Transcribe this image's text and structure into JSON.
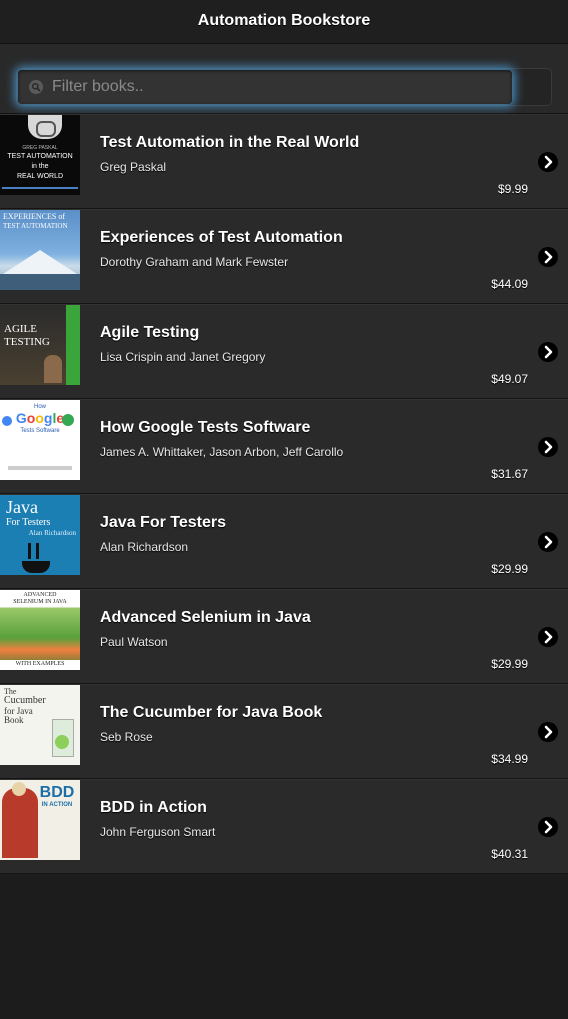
{
  "header": {
    "title": "Automation Bookstore"
  },
  "search": {
    "placeholder": "Filter books.."
  },
  "books": [
    {
      "title": "Test Automation in the Real World",
      "author": "Greg Paskal",
      "price": "$9.99",
      "cover_text": [
        "GREG PASKAL",
        "TEST AUTOMATION",
        "in the",
        "REAL WORLD"
      ]
    },
    {
      "title": "Experiences of Test Automation",
      "author": "Dorothy Graham and Mark Fewster",
      "price": "$44.09",
      "cover_text": [
        "EXPERIENCES of",
        "TEST AUTOMATION"
      ]
    },
    {
      "title": "Agile Testing",
      "author": "Lisa Crispin and Janet Gregory",
      "price": "$49.07",
      "cover_text": [
        "AGILE",
        "TESTING"
      ]
    },
    {
      "title": "How Google Tests Software",
      "author": "James A. Whittaker, Jason Arbon, Jeff Carollo",
      "price": "$31.67",
      "cover_text": [
        "How",
        "Google",
        "Tests Software"
      ]
    },
    {
      "title": "Java For Testers",
      "author": "Alan Richardson",
      "price": "$29.99",
      "cover_text": [
        "Java",
        "For Testers",
        "Alan Richardson"
      ]
    },
    {
      "title": "Advanced Selenium in Java",
      "author": "Paul Watson",
      "price": "$29.99",
      "cover_text": [
        "ADVANCED",
        "SELENIUM IN JAVA",
        "WITH EXAMPLES"
      ]
    },
    {
      "title": "The Cucumber for Java Book",
      "author": "Seb Rose",
      "price": "$34.99",
      "cover_text": [
        "The",
        "Cucumber",
        "for Java",
        "Book"
      ]
    },
    {
      "title": "BDD in Action",
      "author": "John Ferguson Smart",
      "price": "$40.31",
      "cover_text": [
        "BDD",
        "IN ACTION"
      ]
    }
  ],
  "icons": {
    "search": "search-icon",
    "row_arrow": "chevron-right-icon"
  },
  "colors": {
    "focus_glow": "#4a8fbf",
    "background": "#1c1c1c",
    "row": "#2a2a2a"
  }
}
